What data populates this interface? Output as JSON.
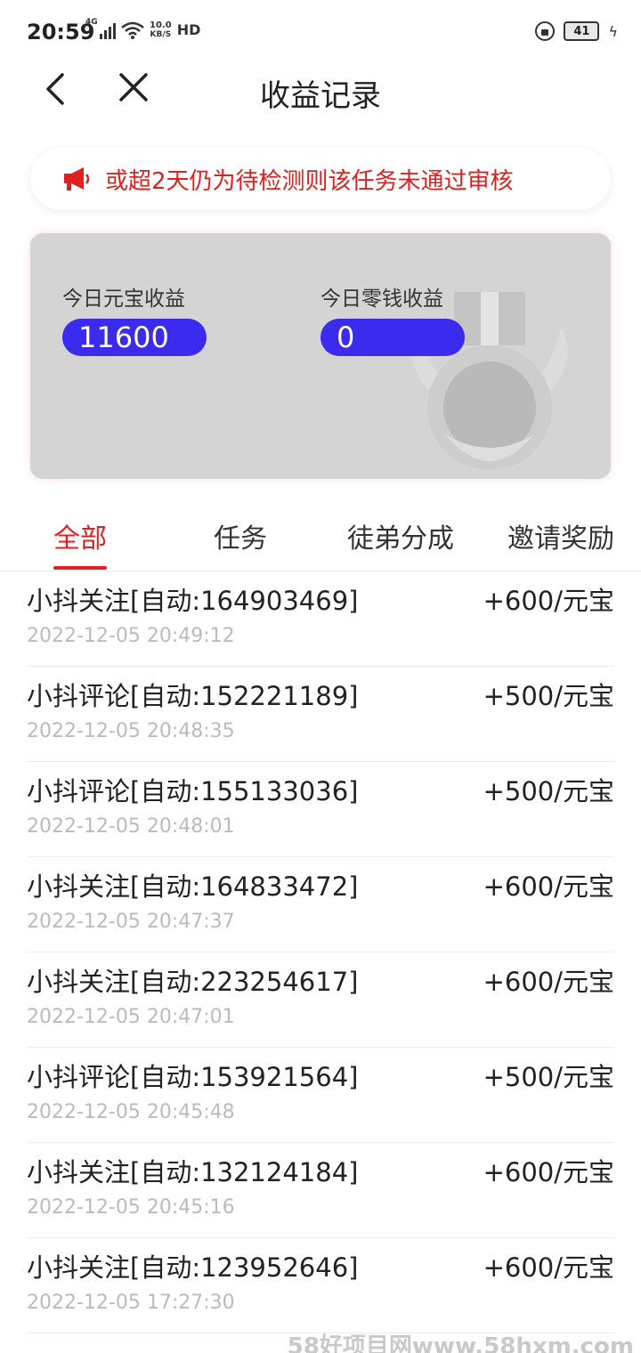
{
  "status_bar": {
    "time": "20:59",
    "network": "4G",
    "speed_value": "10.0",
    "speed_unit": "KB/S",
    "hd": "HD",
    "battery": "41"
  },
  "header": {
    "title": "收益记录"
  },
  "notice": {
    "text": "或超2天仍为待检测则该任务未通过审核"
  },
  "summary": {
    "yuanbao_label": "今日元宝收益",
    "yuanbao_value": "11600",
    "change_label": "今日零钱收益",
    "change_value": "0"
  },
  "tabs": [
    {
      "label": "全部",
      "active": true
    },
    {
      "label": "任务",
      "active": false
    },
    {
      "label": "徒弟分成",
      "active": false
    },
    {
      "label": "邀请奖励",
      "active": false
    }
  ],
  "records": [
    {
      "title": "小抖关注[自动:164903469]",
      "time": "2022-12-05 20:49:12",
      "amount": "+600/元宝"
    },
    {
      "title": "小抖评论[自动:152221189]",
      "time": "2022-12-05 20:48:35",
      "amount": "+500/元宝"
    },
    {
      "title": "小抖评论[自动:155133036]",
      "time": "2022-12-05 20:48:01",
      "amount": "+500/元宝"
    },
    {
      "title": "小抖关注[自动:164833472]",
      "time": "2022-12-05 20:47:37",
      "amount": "+600/元宝"
    },
    {
      "title": "小抖关注[自动:223254617]",
      "time": "2022-12-05 20:47:01",
      "amount": "+600/元宝"
    },
    {
      "title": "小抖评论[自动:153921564]",
      "time": "2022-12-05 20:45:48",
      "amount": "+500/元宝"
    },
    {
      "title": "小抖关注[自动:132124184]",
      "time": "2022-12-05 20:45:16",
      "amount": "+600/元宝"
    },
    {
      "title": "小抖关注[自动:123952646]",
      "time": "2022-12-05 17:27:30",
      "amount": "+600/元宝"
    }
  ],
  "watermark": "58好项目网www.58hxm.com",
  "colors": {
    "accent_red": "#e02020",
    "pill_blue": "#3b2bee",
    "card_gray": "#d4d4d4"
  }
}
